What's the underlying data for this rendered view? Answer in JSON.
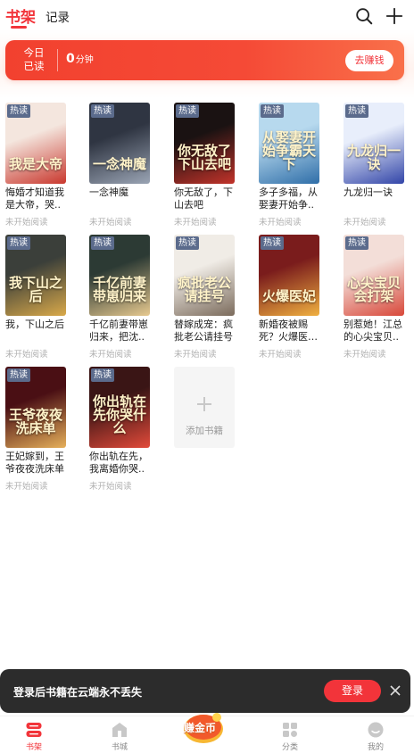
{
  "header": {
    "tab_shelf": "书架",
    "tab_record": "记录",
    "search_icon": "search-icon",
    "add_icon": "plus-icon"
  },
  "banner": {
    "today_line1": "今日",
    "today_line2": "已读",
    "minutes_value": "0",
    "minutes_unit": "分钟",
    "button": "去赚钱"
  },
  "books": [
    {
      "title": "悔婚才知道我是大帝，哭..",
      "status": "未开始阅读",
      "badge": "热读",
      "cover_text": "我是大帝",
      "colors": [
        "#f4e6de",
        "#c9382e"
      ]
    },
    {
      "title": "一念神魔",
      "status": "未开始阅读",
      "badge": "热读",
      "cover_text": "一念神魔",
      "colors": [
        "#2f3542",
        "#9aa4b4"
      ]
    },
    {
      "title": "你无敌了，下山去吧",
      "status": "未开始阅读",
      "badge": "热读",
      "cover_text": "你无敌了下山去吧",
      "colors": [
        "#1a1212",
        "#c2332a"
      ]
    },
    {
      "title": "多子多福，从娶妻开始争..",
      "status": "未开始阅读",
      "badge": "热读",
      "cover_text": "从娶妻开始争霸天下",
      "colors": [
        "#b7d9ee",
        "#2f6ea8"
      ]
    },
    {
      "title": "九龙归一诀",
      "status": "未开始阅读",
      "badge": "热读",
      "cover_text": "九龙归一诀",
      "colors": [
        "#e8eefb",
        "#3245a8"
      ]
    },
    {
      "title": "我，下山之后",
      "status": "未开始阅读",
      "badge": "热读",
      "cover_text": "我下山之后",
      "colors": [
        "#3b3f3a",
        "#d9a94a"
      ]
    },
    {
      "title": "千亿前妻带崽归来，把沈..",
      "status": "未开始阅读",
      "badge": "热读",
      "cover_text": "千亿前妻带崽归来",
      "colors": [
        "#2c3a34",
        "#e7c98f"
      ]
    },
    {
      "title": "替嫁成宠：疯批老公请挂号",
      "status": "未开始阅读",
      "badge": "热读",
      "cover_text": "疯批老公请挂号",
      "colors": [
        "#f0ece6",
        "#7b6b5c"
      ]
    },
    {
      "title": "新婚夜被赐死？火爆医妃..",
      "status": "未开始阅读",
      "badge": "热读",
      "cover_text": "火爆医妃",
      "colors": [
        "#7a1c1c",
        "#f0b040"
      ]
    },
    {
      "title": "别惹她！江总的心尖宝贝..",
      "status": "未开始阅读",
      "badge": "热读",
      "cover_text": "心尖宝贝会打架",
      "colors": [
        "#f3ded8",
        "#d8483a"
      ]
    },
    {
      "title": "王妃嫁到，王爷夜夜洗床单",
      "status": "未开始阅读",
      "badge": "热读",
      "cover_text": "王爷夜夜洗床单",
      "colors": [
        "#4a0f14",
        "#e6b05a"
      ]
    },
    {
      "title": "你出轨在先，我离婚你哭..",
      "status": "未开始阅读",
      "badge": "热读",
      "cover_text": "你出轨在先你哭什么",
      "colors": [
        "#3a1515",
        "#e24a3a"
      ]
    }
  ],
  "add_book": {
    "label": "添加书籍"
  },
  "login_prompt": {
    "text": "登录后书籍在云端永不丢失",
    "button": "登录"
  },
  "bottom_nav": [
    {
      "label": "书架",
      "icon": "bookshelf-icon",
      "active": true
    },
    {
      "label": "书城",
      "icon": "bookstore-icon",
      "active": false
    },
    {
      "label": "赚金币",
      "icon": "coin-icon",
      "active": false
    },
    {
      "label": "分类",
      "icon": "category-icon",
      "active": false
    },
    {
      "label": "我的",
      "icon": "profile-icon",
      "active": false
    }
  ],
  "colors": {
    "accent": "#f2343a",
    "banner": "#f2412f",
    "badge": "#5b6b8c"
  }
}
